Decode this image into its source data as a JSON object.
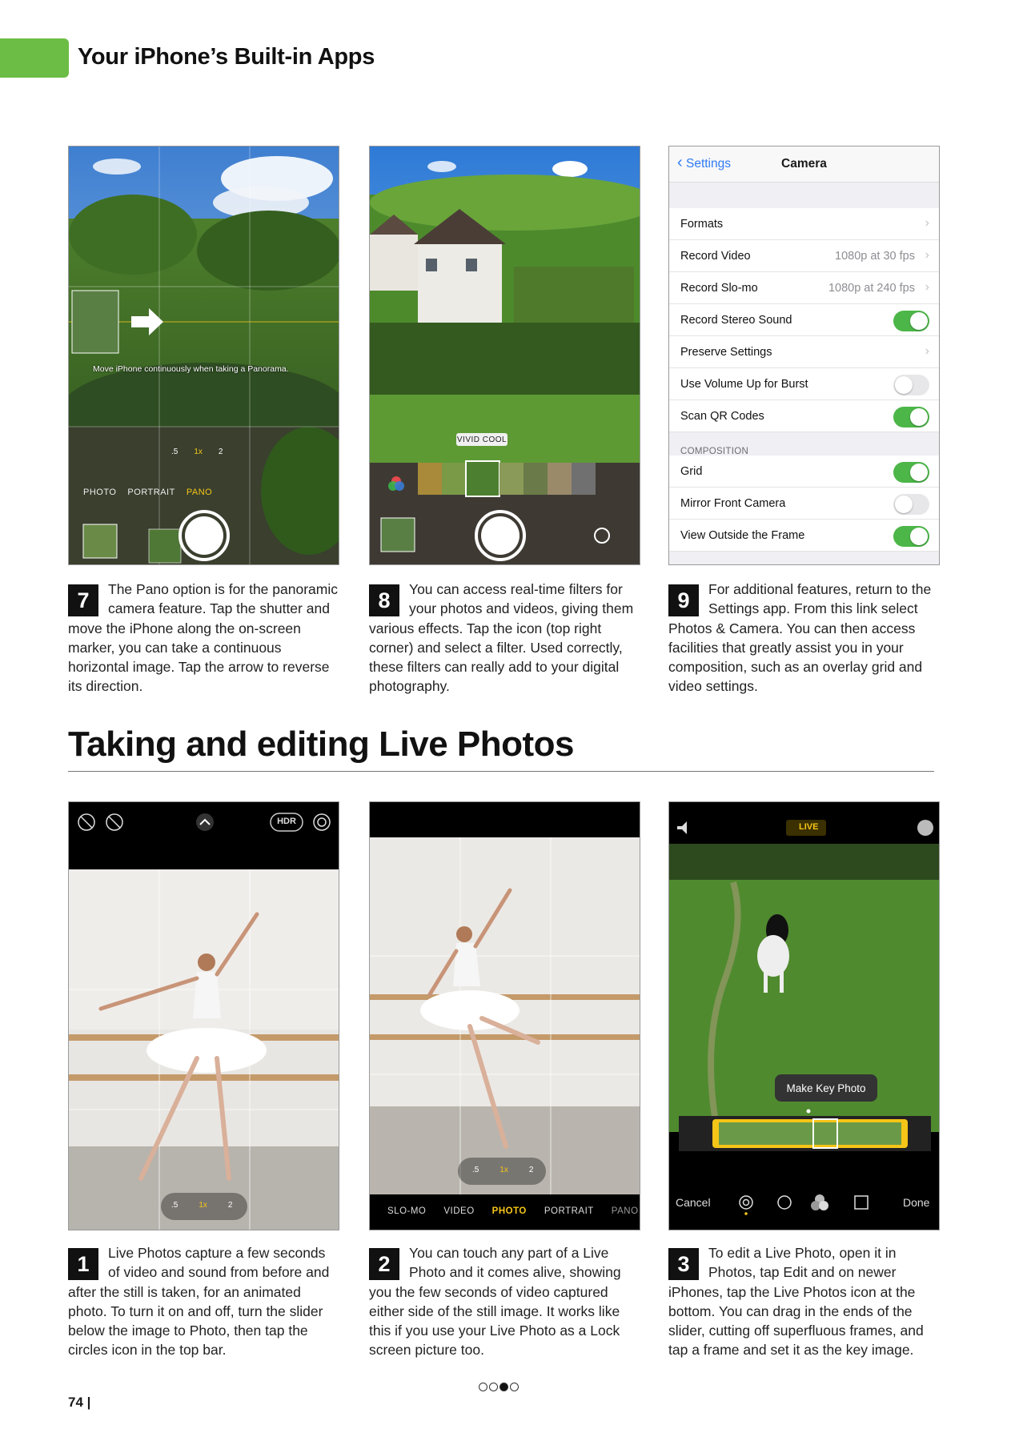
{
  "header": {
    "title": "Your iPhone’s Built-in Apps"
  },
  "top_row": {
    "shot7": {
      "pano_hint": "Move iPhone continuously when taking a Panorama.",
      "zoom": [
        ".5",
        "1x",
        "2"
      ],
      "modes": [
        "PHOTO",
        "PORTRAIT",
        "PANO"
      ]
    },
    "shot8": {
      "filter_label": "VIVID COOL"
    },
    "shot9": {
      "back_label": "Settings",
      "title": "Camera",
      "rows_a": [
        {
          "label": "Formats",
          "value": "",
          "control": "chevron"
        },
        {
          "label": "Record Video",
          "value": "1080p at 30 fps",
          "control": "chevron"
        },
        {
          "label": "Record Slo-mo",
          "value": "1080p at 240 fps",
          "control": "chevron"
        },
        {
          "label": "Record Stereo Sound",
          "value": "",
          "control": "on"
        },
        {
          "label": "Preserve Settings",
          "value": "",
          "control": "chevron"
        },
        {
          "label": "Use Volume Up for Burst",
          "value": "",
          "control": "off"
        },
        {
          "label": "Scan QR Codes",
          "value": "",
          "control": "on"
        }
      ],
      "section_label": "COMPOSITION",
      "rows_b": [
        {
          "label": "Grid",
          "value": "",
          "control": "on"
        },
        {
          "label": "Mirror Front Camera",
          "value": "",
          "control": "off"
        },
        {
          "label": "View Outside the Frame",
          "value": "",
          "control": "on"
        }
      ]
    }
  },
  "captions_top": [
    {
      "num": "7",
      "text": "The Pano option is for the panoramic camera feature. Tap the shutter and move the iPhone along the on-screen marker, you can take a continuous horizontal image. Tap the arrow to reverse its direction."
    },
    {
      "num": "8",
      "text": "You can access real-time filters for your photos and videos, giving them various effects. Tap the icon (top right corner) and select a filter. Used correctly, these filters can really add to your digital photography."
    },
    {
      "num": "9",
      "text": "For additional features, return to the Settings app. From this link select Photos & Camera. You can then access facilities that greatly assist you in your composition, such as an overlay grid and video settings."
    }
  ],
  "section_title": "Taking and editing Live Photos",
  "bottom_row": {
    "shot1": {
      "hdr": "HDR",
      "zoom": [
        ".5",
        "1x",
        "2"
      ]
    },
    "shot2": {
      "zoom": [
        ".5",
        "1x",
        "2"
      ],
      "modes": [
        "SLO-MO",
        "VIDEO",
        "PHOTO",
        "PORTRAIT",
        "PANO"
      ]
    },
    "shot3": {
      "live_badge": "LIVE",
      "tooltip": "Make Key Photo",
      "cancel": "Cancel",
      "done": "Done"
    }
  },
  "captions_bottom": [
    {
      "num": "1",
      "text": "Live Photos capture a few seconds of video and sound from before and after the still is taken, for an animated photo. To turn it on and off, turn the slider below the image to Photo, then tap the circles icon in the top bar."
    },
    {
      "num": "2",
      "text": "You can touch any part of a Live Photo and it comes alive, showing you the few seconds of video captured either side of the still image. It works like this if you use your Live Photo as a Lock screen picture too."
    },
    {
      "num": "3",
      "text": "To edit a Live Photo, open it in Photos, tap Edit and on newer iPhones, tap the Live Photos icon at the bottom. You can drag in the ends of the slider, cutting off superfluous frames, and tap a frame and set it as the key image."
    }
  ],
  "footer": {
    "page_number": "74 |"
  },
  "colors": {
    "accent_green": "#6cbd45",
    "ios_green": "#4cb648",
    "ios_blue": "#2f7bf6",
    "camera_yellow": "#f5c518"
  },
  "icons": [
    "chevron-left-icon",
    "chevron-right-icon",
    "flash-off-icon",
    "live-off-icon",
    "chevron-up-icon",
    "live-photo-icon",
    "speaker-icon",
    "more-icon",
    "adjust-icon",
    "filters-icon",
    "crop-icon",
    "filter-icon",
    "flip-camera-icon",
    "arrow-right-icon"
  ]
}
